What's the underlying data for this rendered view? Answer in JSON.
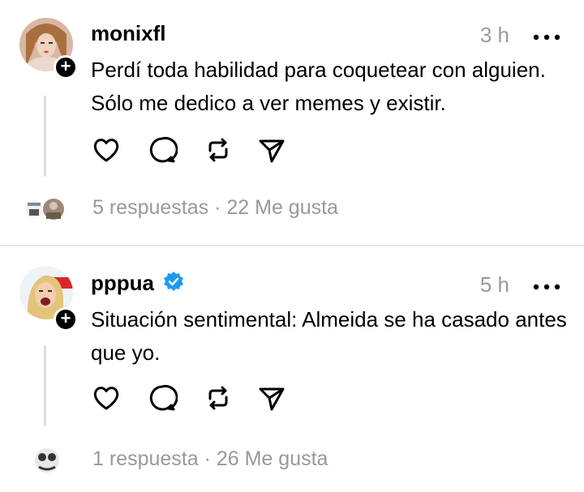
{
  "posts": [
    {
      "username": "monixfl",
      "verified": false,
      "time": "3 h",
      "text": "Perdí toda habilidad para coquetear con alguien. Sólo me dedico a ver memes y existir.",
      "replies_label": "5 respuestas",
      "separator": "·",
      "likes_label": "22 Me gusta",
      "reply_avatar_count": 2
    },
    {
      "username": "pppua",
      "verified": true,
      "time": "5 h",
      "text": "Situación sentimental: Almeida se ha casado antes que yo.",
      "replies_label": "1 respuesta",
      "separator": "·",
      "likes_label": "26 Me gusta",
      "reply_avatar_count": 1
    }
  ],
  "icons": {
    "more": "more-horizontal-icon",
    "like": "heart-icon",
    "reply": "comment-icon",
    "repost": "repost-icon",
    "share": "send-icon",
    "follow": "plus-icon",
    "verified": "verified-badge-icon"
  },
  "colors": {
    "text": "#000000",
    "muted": "#999999",
    "divider": "#e6e6e6",
    "verified": "#1d9bf0"
  }
}
